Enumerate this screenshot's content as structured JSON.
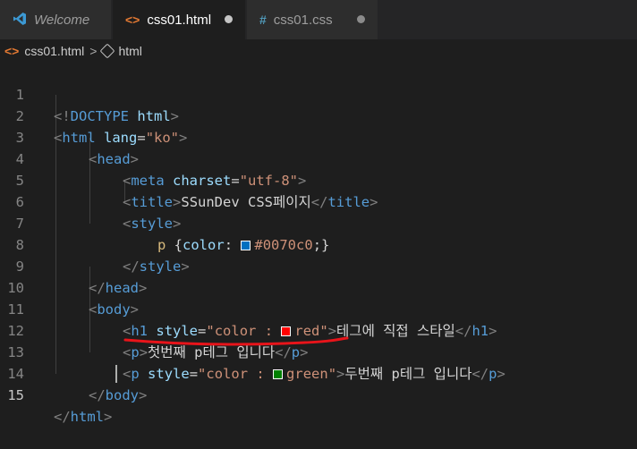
{
  "tabs": [
    {
      "name": "Welcome",
      "icon": "vscode-icon",
      "active": false
    },
    {
      "name": "css01.html",
      "icon": "html-icon",
      "active": true,
      "modified": true
    },
    {
      "name": "css01.css",
      "icon": "css-icon",
      "active": false,
      "modified": true
    }
  ],
  "breadcrumb": {
    "file": "css01.html",
    "separator": ">",
    "symbol": "html"
  },
  "editor": {
    "current_line": 15,
    "line_numbers": [
      "1",
      "2",
      "3",
      "4",
      "5",
      "6",
      "7",
      "8",
      "9",
      "10",
      "11",
      "12",
      "13",
      "14",
      "15"
    ],
    "lines": {
      "l1": {
        "lt": "<!",
        "tag": "DOCTYPE",
        "sp": " ",
        "attr": "html",
        "gt": ">"
      },
      "l2": {
        "lt": "<",
        "tag": "html",
        "sp": " ",
        "attr": "lang",
        "eq": "=",
        "val": "\"ko\"",
        "gt": ">"
      },
      "l3": {
        "lt": "<",
        "tag": "head",
        "gt": ">"
      },
      "l4": {
        "lt": "<",
        "tag": "meta",
        "sp": " ",
        "attr": "charset",
        "eq": "=",
        "val": "\"utf-8\"",
        "gt": ">"
      },
      "l5": {
        "lt": "<",
        "tag": "title",
        "gt": ">",
        "text": "SSunDev CSS페이지",
        "lt2": "</",
        "tag2": "title",
        "gt2": ">"
      },
      "l6": {
        "lt": "<",
        "tag": "style",
        "gt": ">"
      },
      "l7": {
        "selector": "p",
        "open": " {",
        "prop": "color",
        "colon": ": ",
        "value": "#0070c0",
        "close": ";}"
      },
      "l8": {
        "lt": "</",
        "tag": "style",
        "gt": ">"
      },
      "l9": {
        "lt": "</",
        "tag": "head",
        "gt": ">"
      },
      "l10": {
        "lt": "<",
        "tag": "body",
        "gt": ">"
      },
      "l11": {
        "lt": "<",
        "tag": "h1",
        "sp": " ",
        "attr": "style",
        "eq": "=",
        "val1": "\"color : ",
        "val2": "red\"",
        "gt": ">",
        "text": "테그에 직접 스타일",
        "lt2": "</",
        "tag2": "h1",
        "gt2": ">"
      },
      "l12": {
        "lt": "<",
        "tag": "p",
        "gt": ">",
        "text": "첫번째 p테그 입니다",
        "lt2": "</",
        "tag2": "p",
        "gt2": ">"
      },
      "l13": {
        "lt": "<",
        "tag": "p",
        "sp": " ",
        "attr": "style",
        "eq": "=",
        "val1": "\"color : ",
        "val2": "green\"",
        "gt": ">",
        "text": "두번째 p테그 입니다",
        "lt2": "</",
        "tag2": "p",
        "gt2": ">"
      },
      "l14": {
        "lt": "</",
        "tag": "body",
        "gt": ">"
      },
      "l15": {
        "lt": "</",
        "tag": "html",
        "gt": ">"
      }
    }
  },
  "colors": {
    "swatch_blue": "#0070c0",
    "swatch_red": "#ff0000",
    "swatch_green": "#008000",
    "annotation_underline": "#e8141a"
  }
}
